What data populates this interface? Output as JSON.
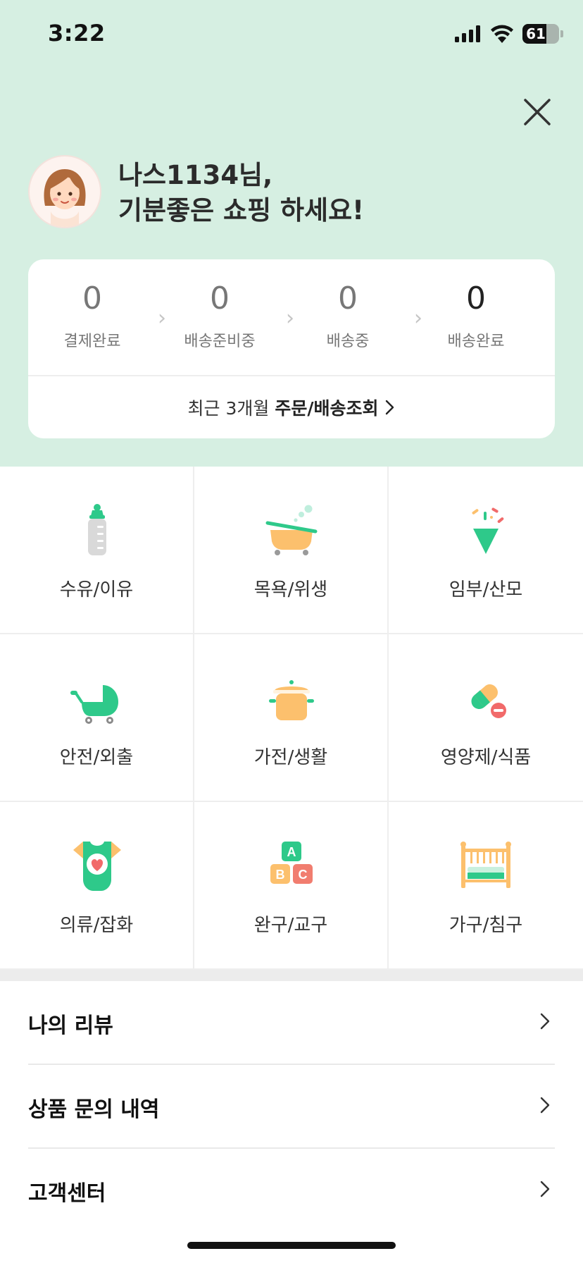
{
  "status_bar": {
    "time": "3:22",
    "battery": "61"
  },
  "header": {
    "greeting_line1": "나스1134님,",
    "greeting_line2": "기분좋은 쇼핑 하세요!"
  },
  "order_status": {
    "steps": [
      {
        "count": "0",
        "label": "결제완료"
      },
      {
        "count": "0",
        "label": "배송준비중"
      },
      {
        "count": "0",
        "label": "배송중"
      },
      {
        "count": "0",
        "label": "배송완료"
      }
    ],
    "link_prefix": "최근 3개월",
    "link_bold": "주문/배송조회"
  },
  "categories": [
    {
      "label": "수유/이유",
      "icon": "baby-bottle-icon"
    },
    {
      "label": "목욕/위생",
      "icon": "bathtub-icon"
    },
    {
      "label": "임부/산모",
      "icon": "confetti-icon"
    },
    {
      "label": "안전/외출",
      "icon": "stroller-icon"
    },
    {
      "label": "가전/생활",
      "icon": "pot-icon"
    },
    {
      "label": "영양제/식품",
      "icon": "pill-icon"
    },
    {
      "label": "의류/잡화",
      "icon": "onesie-icon"
    },
    {
      "label": "완구/교구",
      "icon": "abc-blocks-icon"
    },
    {
      "label": "가구/침구",
      "icon": "crib-icon"
    }
  ],
  "block_letters": {
    "a": "A",
    "b": "B",
    "c": "C"
  },
  "menu": [
    {
      "label": "나의 리뷰"
    },
    {
      "label": "상품 문의 내역"
    },
    {
      "label": "고객센터"
    }
  ],
  "colors": {
    "header_bg": "#d6efe2",
    "green": "#2ec98a",
    "orange": "#fcc06d",
    "accent_red": "#f16a6a"
  }
}
